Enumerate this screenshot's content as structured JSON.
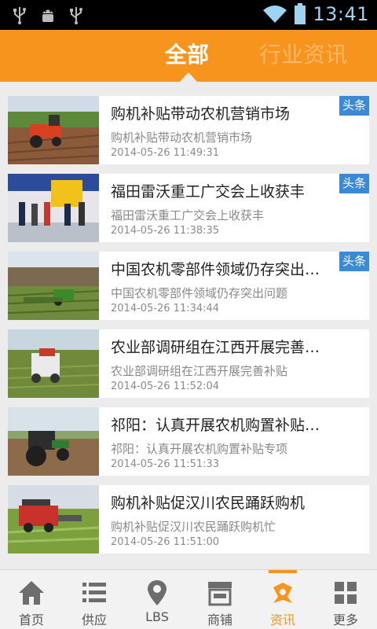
{
  "status_bar": {
    "time": "13:41",
    "icons": [
      "usb-icon",
      "android-debug-icon",
      "usb-icon",
      "wifi-icon",
      "battery-icon"
    ]
  },
  "header": {
    "tabs": [
      {
        "label": "全部",
        "active": true
      },
      {
        "label": "行业资讯",
        "active": false
      }
    ]
  },
  "news": [
    {
      "title": "购机补贴带动农机营销市场",
      "summary": "购机补贴带动农机营销市场",
      "time": "2014-05-26 11:49:31",
      "badge": "头条"
    },
    {
      "title": "福田雷沃重工广交会上收获丰",
      "summary": "福田雷沃重工广交会上收获丰",
      "time": "2014-05-26 11:38:35",
      "badge": "头条"
    },
    {
      "title": "中国农机零部件领域仍存突出问题",
      "summary": "中国农机零部件领域仍存突出问题",
      "time": "2014-05-26 11:34:44",
      "badge": "头条"
    },
    {
      "title": " 农业部调研组在江西开展完善补贴",
      "summary": " 农业部调研组在江西开展完善补贴",
      "time": "2014-05-26 11:52:04",
      "badge": ""
    },
    {
      "title": "祁阳：认真开展农机购置补贴专项",
      "summary": "祁阳：认真开展农机购置补贴专项",
      "time": "2014-05-26 11:51:33",
      "badge": ""
    },
    {
      "title": "购机补贴促汉川农民踊跃购机",
      "summary": "购机补贴促汉川农民踊跃购机忙",
      "time": "2014-05-26 11:51:00",
      "badge": ""
    }
  ],
  "bottom_nav": [
    {
      "label": "首页",
      "icon": "home-icon"
    },
    {
      "label": "供应",
      "icon": "list-icon"
    },
    {
      "label": "LBS",
      "icon": "location-pin-icon"
    },
    {
      "label": "商铺",
      "icon": "shop-icon"
    },
    {
      "label": "资讯",
      "icon": "news-icon",
      "active": true
    },
    {
      "label": "更多",
      "icon": "grid-icon"
    }
  ],
  "colors": {
    "accent": "#f7941e",
    "badge": "#3a8ad7",
    "background": "#ececec"
  }
}
